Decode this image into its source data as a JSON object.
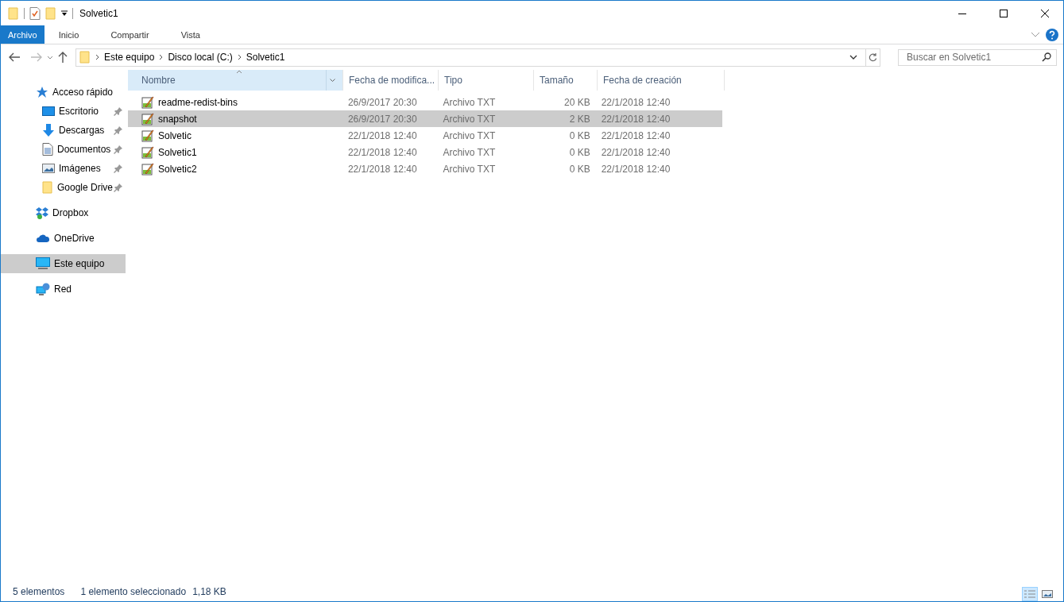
{
  "window": {
    "title": "Solvetic1"
  },
  "ribbon_tabs": [
    {
      "label": "Archivo",
      "kind": "file"
    },
    {
      "label": "Inicio",
      "kind": "tab"
    },
    {
      "label": "Compartir",
      "kind": "tab"
    },
    {
      "label": "Vista",
      "kind": "tab"
    }
  ],
  "address": {
    "path": [
      "Este equipo",
      "Disco local (C:)",
      "Solvetic1"
    ]
  },
  "search": {
    "placeholder": "Buscar en Solvetic1"
  },
  "nav": [
    {
      "label": "Acceso rápido",
      "kind": "star",
      "selected": false,
      "children": [
        {
          "label": "Escritorio",
          "kind": "desktop",
          "pinned": true,
          "selected": false
        },
        {
          "label": "Descargas",
          "kind": "download",
          "pinned": true,
          "selected": false
        },
        {
          "label": "Documentos",
          "kind": "document",
          "pinned": true,
          "selected": false
        },
        {
          "label": "Imágenes",
          "kind": "image",
          "pinned": true,
          "selected": false
        },
        {
          "label": "Google Drive",
          "kind": "folder",
          "pinned": true,
          "selected": false
        }
      ]
    },
    {
      "label": "Dropbox",
      "kind": "dropbox",
      "selected": false
    },
    {
      "label": "OneDrive",
      "kind": "cloud",
      "selected": false
    },
    {
      "label": "Este equipo",
      "kind": "computer",
      "selected": true
    },
    {
      "label": "Red",
      "kind": "network",
      "selected": false
    }
  ],
  "columns": [
    {
      "label": "Nombre",
      "sorted": true
    },
    {
      "label": "Fecha de modifica...",
      "sorted": false
    },
    {
      "label": "Tipo",
      "sorted": false
    },
    {
      "label": "Tamaño",
      "sorted": false
    },
    {
      "label": "Fecha de creación",
      "sorted": false
    }
  ],
  "rows": [
    {
      "name": "readme-redist-bins",
      "modified": "26/9/2017 20:30",
      "type": "Archivo TXT",
      "size": "20 KB",
      "created": "22/1/2018 12:40",
      "selected": false
    },
    {
      "name": "snapshot",
      "modified": "26/9/2017 20:30",
      "type": "Archivo TXT",
      "size": "2 KB",
      "created": "22/1/2018 12:40",
      "selected": true
    },
    {
      "name": "Solvetic",
      "modified": "22/1/2018 12:40",
      "type": "Archivo TXT",
      "size": "0 KB",
      "created": "22/1/2018 12:40",
      "selected": false
    },
    {
      "name": "Solvetic1",
      "modified": "22/1/2018 12:40",
      "type": "Archivo TXT",
      "size": "0 KB",
      "created": "22/1/2018 12:40",
      "selected": false
    },
    {
      "name": "Solvetic2",
      "modified": "22/1/2018 12:40",
      "type": "Archivo TXT",
      "size": "0 KB",
      "created": "22/1/2018 12:40",
      "selected": false
    }
  ],
  "status_bar": {
    "count": "5 elementos",
    "selection": "1 elemento seleccionado",
    "size": "1,18 KB"
  },
  "view_buttons": [
    {
      "kind": "details",
      "selected": true
    },
    {
      "kind": "tiles",
      "selected": false
    }
  ]
}
